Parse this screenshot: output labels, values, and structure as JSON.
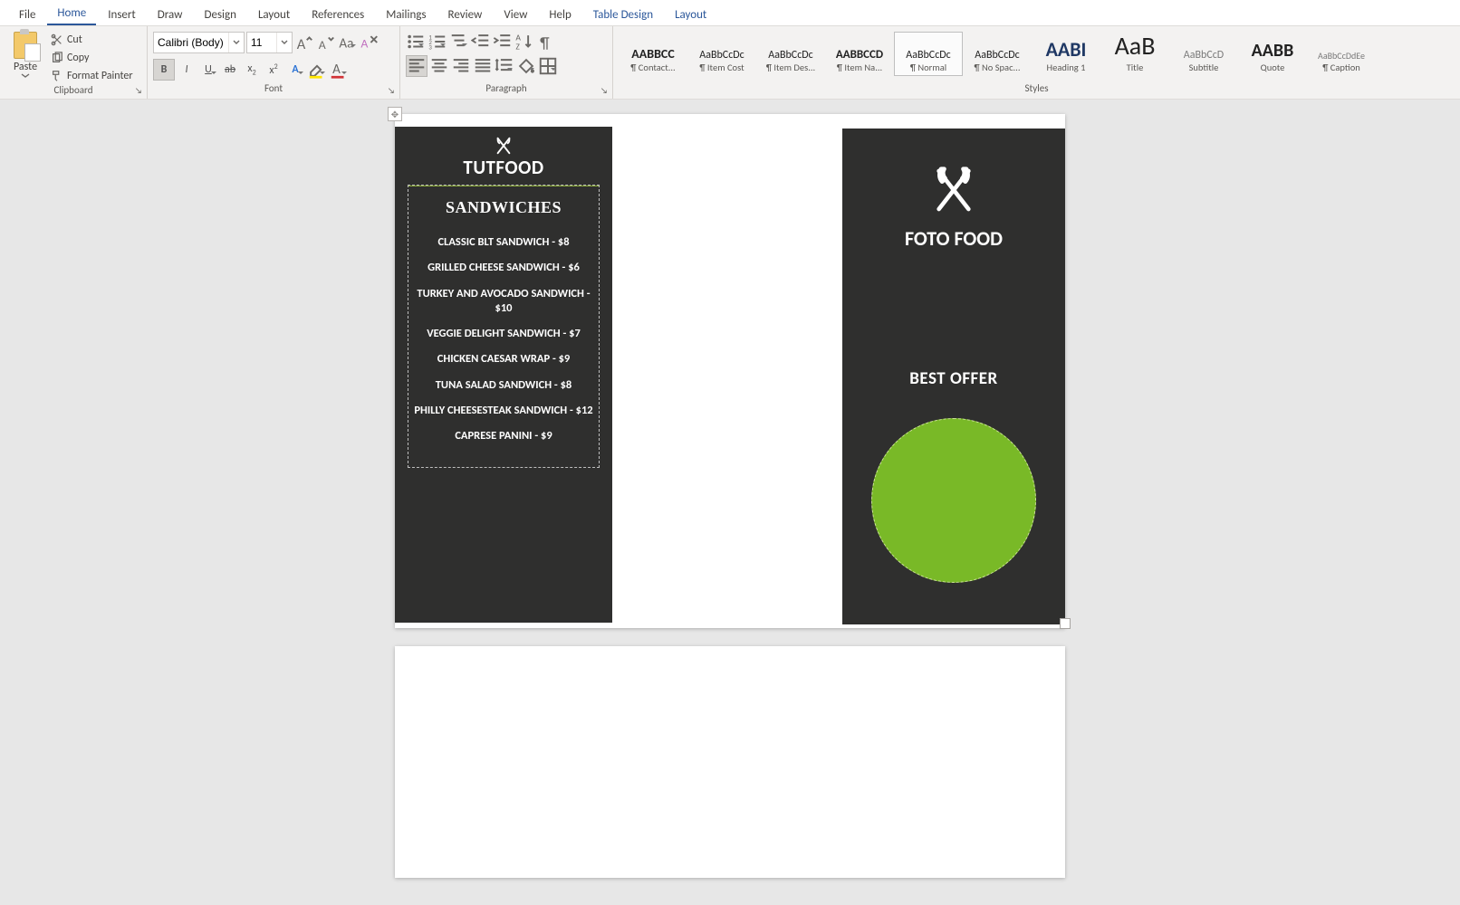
{
  "tabs": {
    "file": "File",
    "home": "Home",
    "insert": "Insert",
    "draw": "Draw",
    "design": "Design",
    "layout": "Layout",
    "references": "References",
    "mailings": "Mailings",
    "review": "Review",
    "view": "View",
    "help": "Help",
    "table_design": "Table Design",
    "layout2": "Layout"
  },
  "clipboard": {
    "paste": "Paste",
    "cut": "Cut",
    "copy": "Copy",
    "format_painter": "Format Painter",
    "group": "Clipboard"
  },
  "font": {
    "family": "Calibri (Body)",
    "size": "11",
    "group": "Font"
  },
  "paragraph": {
    "group": "Paragraph"
  },
  "styles": {
    "group": "Styles",
    "items": [
      {
        "preview": "AABBCC",
        "name": "¶ Contact..."
      },
      {
        "preview": "AaBbCcDc",
        "name": "¶ Item Cost"
      },
      {
        "preview": "AaBbCcDc",
        "name": "¶ Item Des..."
      },
      {
        "preview": "AABBCCD",
        "name": "¶ Item Na..."
      },
      {
        "preview": "AaBbCcDc",
        "name": "¶ Normal",
        "selected": true
      },
      {
        "preview": "AaBbCcDc",
        "name": "¶ No Spac..."
      },
      {
        "preview": "AABI",
        "name": "Heading 1"
      },
      {
        "preview": "AaB",
        "name": "Title"
      },
      {
        "preview": "AaBbCcD",
        "name": "Subtitle"
      },
      {
        "preview": "AABB",
        "name": "Quote"
      },
      {
        "preview": "AaBbCcDdEe",
        "name": "¶ Caption"
      }
    ]
  },
  "doc": {
    "left": {
      "title": "TUTFOOD",
      "section": "SANDWICHES",
      "items": [
        "CLASSIC BLT SANDWICH - $8",
        "GRILLED CHEESE SANDWICH - $6",
        "TURKEY AND AVOCADO SANDWICH - $10",
        "VEGGIE DELIGHT SANDWICH - $7",
        "CHICKEN CAESAR WRAP - $9",
        "TUNA SALAD SANDWICH - $8",
        "PHILLY CHEESESTEAK SANDWICH - $12",
        "CAPRESE PANINI - $9"
      ]
    },
    "right": {
      "title": "FOTO FOOD",
      "offer": "BEST OFFER"
    }
  }
}
